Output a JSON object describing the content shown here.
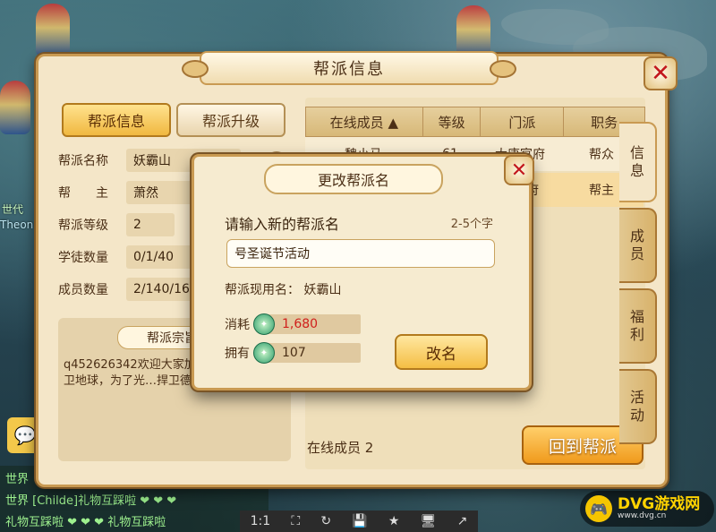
{
  "window": {
    "title": "帮派信息"
  },
  "left_tabs": {
    "info": "帮派信息",
    "upgrade": "帮派升级"
  },
  "guild_info": [
    {
      "label": "帮派名称",
      "value": "妖霸山"
    },
    {
      "label": "帮　　主",
      "value": "萧然"
    },
    {
      "label": "帮派等级",
      "value": "2"
    },
    {
      "label": "学徒数量",
      "value": "0/1/40"
    },
    {
      "label": "成员数量",
      "value": "2/140/16"
    }
  ],
  "intro": {
    "title": "帮派宗旨",
    "text": "q452626342欢迎大家加入…派任务，保卫地球，为了光…捍卫德玛西亚的荣耀！"
  },
  "member_table": {
    "headers": [
      "在线成员 ▲",
      "等级",
      "门派",
      "职务"
    ],
    "rows": [
      {
        "name": "魏小马",
        "level": "61",
        "school": "大唐官府",
        "role": "帮众"
      },
      {
        "name": "",
        "level": "",
        "school": "…官府",
        "role": "帮主"
      }
    ]
  },
  "online_count": {
    "label": "在线成员",
    "value": "2"
  },
  "back_button": "回到帮派",
  "side_tabs": [
    "信息",
    "成员",
    "福利",
    "活动"
  ],
  "dialog": {
    "title": "更改帮派名",
    "prompt": "请输入新的帮派名",
    "hint": "2-5个字",
    "input_value": "号圣诞节活动",
    "current_name_label": "帮派现用名：",
    "current_name": "妖霸山",
    "cost_label": "消耗",
    "cost_value": "1,680",
    "own_label": "拥有",
    "own_value": "107",
    "rename_button": "改名"
  },
  "scene": {
    "label_world": "世代",
    "label_player": "Theon",
    "chat_lines": [
      "世界 [Childe]礼物互踩啦 ❤ ❤ ❤",
      "礼物互踩啦 ❤ ❤ ❤ 礼物互踩啦"
    ],
    "chat_world": "世界"
  },
  "toolbar": [
    "1:1",
    "⛶",
    "↻",
    "💾",
    "★",
    "🖥",
    "↗"
  ],
  "logo": {
    "name": "DVG游戏网",
    "url": "www.dvg.cn"
  },
  "colors": {
    "accent": "#f4be44",
    "frame": "#c99a52",
    "cost_text": "#d0201c"
  }
}
